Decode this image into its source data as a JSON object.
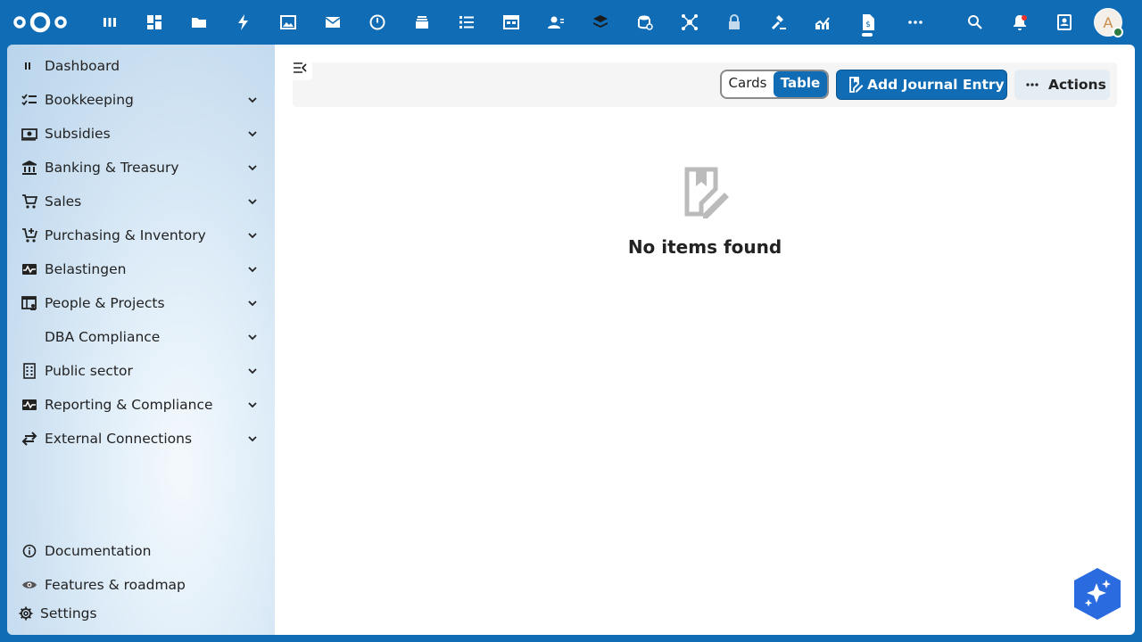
{
  "topbar": {
    "apps": [
      "dashboard-icon",
      "grid-icon",
      "folder-icon",
      "activity-icon",
      "photos-icon",
      "mail-icon",
      "clock-icon",
      "deck-icon",
      "tasks-icon",
      "calendar-icon",
      "contacts-icon",
      "stack-icon",
      "database-icon",
      "hub-icon",
      "lock-icon",
      "gavel-icon",
      "chart-icon",
      "finance-icon",
      "more-icon"
    ],
    "avatar_initial": "A"
  },
  "sidebar": {
    "items": [
      {
        "label": "Dashboard",
        "icon": "dashboard-icon"
      },
      {
        "label": "Bookkeeping",
        "icon": "checklist-icon"
      },
      {
        "label": "Subsidies",
        "icon": "money-icon"
      },
      {
        "label": "Banking & Treasury",
        "icon": "bank-icon"
      },
      {
        "label": "Sales",
        "icon": "cart-icon"
      },
      {
        "label": "Purchasing & Inventory",
        "icon": "cart-plus-icon"
      },
      {
        "label": "Belastingen",
        "icon": "pulse-icon"
      },
      {
        "label": "People & Projects",
        "icon": "people-table-icon"
      },
      {
        "label": "DBA Compliance",
        "icon": ""
      },
      {
        "label": "Public sector",
        "icon": "building-icon"
      },
      {
        "label": "Reporting & Compliance",
        "icon": "pulse-icon"
      },
      {
        "label": "External Connections",
        "icon": "swap-icon"
      }
    ],
    "footer": [
      {
        "label": "Documentation",
        "icon": "info-icon"
      },
      {
        "label": "Features & roadmap",
        "icon": "eye-icon"
      },
      {
        "label": "Settings",
        "icon": "gear-icon"
      }
    ]
  },
  "toolbar": {
    "view_cards": "Cards",
    "view_table": "Table",
    "active_view": "Table",
    "add_label": "Add Journal Entry",
    "actions_label": "Actions"
  },
  "content": {
    "empty_text": "No items found"
  },
  "colors": {
    "primary": "#0f6cb5",
    "status_online": "#2d7b41",
    "notification": "#e9322d"
  }
}
